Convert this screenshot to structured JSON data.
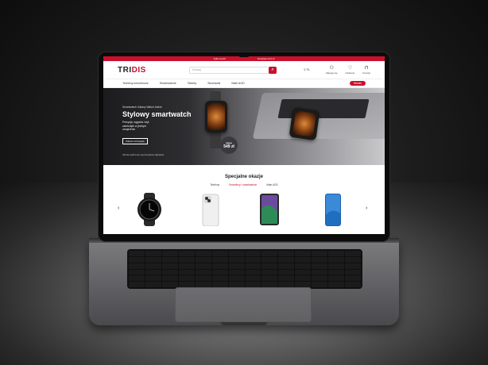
{
  "site": {
    "topbar": {
      "left": "Tylko teraz!",
      "right": "Dostawa od 0 zł"
    },
    "logo": {
      "main": "TRI",
      "accent": "DIS"
    },
    "search": {
      "placeholder": "Szukaj"
    },
    "language": "PL",
    "header_items": [
      {
        "icon": "user-icon",
        "label": "Zaloguj się"
      },
      {
        "icon": "heart-icon",
        "label": "Ulubione"
      },
      {
        "icon": "bag-icon",
        "label": "Koszyk"
      }
    ],
    "nav": [
      "Telefony komórkowe",
      "Smartwatche",
      "Tablety",
      "Słuchawki",
      "Małe AGD"
    ],
    "service_button": "Serwis",
    "hero": {
      "eyebrow": "Smartwatch Galaxy Watch Active",
      "title": "Stylowy smartwatch",
      "desc": "Precyzja, wygoda i styl zamknięte w jednym urządzeniu",
      "button": "Zobacz szczegóły",
      "note": "Oferta ważna do wyczerpania zapasów",
      "old_price": "699 zł",
      "new_price": "549 zł"
    },
    "deals": {
      "title": "Specjalne okazje",
      "tabs": [
        "Telefony",
        "Smartfony i smartwatche",
        "Małe AGD"
      ],
      "active_tab": 1
    }
  },
  "colors": {
    "accent": "#c8102e"
  }
}
